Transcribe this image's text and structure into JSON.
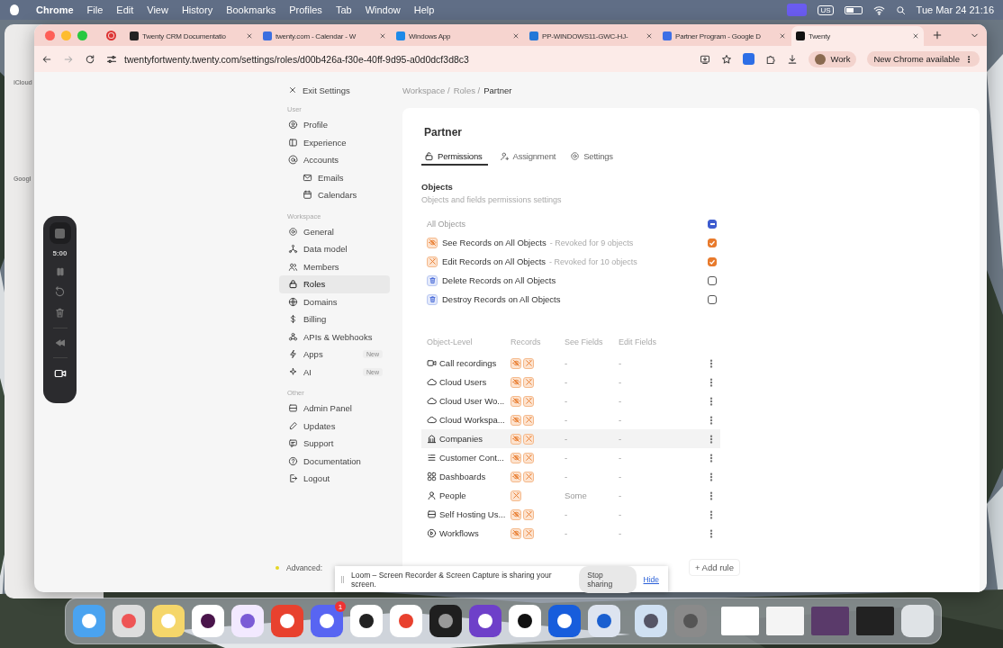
{
  "menubar": {
    "app": "Chrome",
    "menus": [
      "File",
      "Edit",
      "View",
      "History",
      "Bookmarks",
      "Profiles",
      "Tab",
      "Window",
      "Help"
    ],
    "input_source": "US",
    "clock": "Tue Mar 24  21:16"
  },
  "background_window": {
    "groups": [
      {
        "title": "iCloud"
      },
      {
        "title": "Googl"
      }
    ]
  },
  "browser": {
    "tabs": [
      {
        "title": "Twenty CRM Documentatio",
        "selected": false
      },
      {
        "title": "twenty.com - Calendar - W",
        "selected": false
      },
      {
        "title": "Windows App",
        "selected": false
      },
      {
        "title": "PP-WINDOWS11-GWC-HJ-",
        "selected": false
      },
      {
        "title": "Partner Program - Google D",
        "selected": false
      },
      {
        "title": "Twenty",
        "selected": true
      }
    ],
    "url": "twentyfortwenty.twenty.com/settings/roles/d00b426a-f30e-40ff-9d95-a0d0dcf3d8c3",
    "profile": "Work",
    "update_button": "New Chrome available"
  },
  "recorder": {
    "timer": "5:00"
  },
  "settings": {
    "exit": "Exit Settings",
    "groups": [
      {
        "title": "User",
        "items": [
          {
            "label": "Profile",
            "selected": false
          },
          {
            "label": "Experience",
            "selected": false
          },
          {
            "label": "Accounts",
            "selected": false,
            "children": [
              {
                "label": "Emails",
                "selected": false
              },
              {
                "label": "Calendars",
                "selected": false
              }
            ]
          }
        ]
      },
      {
        "title": "Workspace",
        "items": [
          {
            "label": "General",
            "selected": false
          },
          {
            "label": "Data model",
            "selected": false
          },
          {
            "label": "Members",
            "selected": false
          },
          {
            "label": "Roles",
            "selected": true
          },
          {
            "label": "Domains",
            "selected": false
          },
          {
            "label": "Billing",
            "selected": false
          },
          {
            "label": "APIs & Webhooks",
            "selected": false
          },
          {
            "label": "Apps",
            "selected": false,
            "badge": "New"
          },
          {
            "label": "AI",
            "selected": false,
            "badge": "New"
          }
        ]
      },
      {
        "title": "Other",
        "items": [
          {
            "label": "Admin Panel",
            "selected": false
          },
          {
            "label": "Updates",
            "selected": false
          },
          {
            "label": "Support",
            "selected": false
          },
          {
            "label": "Documentation",
            "selected": false
          },
          {
            "label": "Logout",
            "selected": false
          }
        ]
      }
    ],
    "advanced": "Advanced:"
  },
  "role": {
    "breadcrumb": [
      "Workspace /",
      "Roles /",
      "Partner"
    ],
    "title": "Partner",
    "tabs": [
      {
        "label": "Permissions",
        "selected": true
      },
      {
        "label": "Assignment",
        "selected": false
      },
      {
        "label": "Settings",
        "selected": false
      }
    ],
    "objects": {
      "title": "Objects",
      "description": "Objects and fields permissions settings",
      "all": {
        "label": "All Objects",
        "indeterminate": true
      },
      "permissions": [
        {
          "kind": "see",
          "label": "See Records on All Objects",
          "note": "- Revoked for 9 objects",
          "checked": true
        },
        {
          "kind": "edit",
          "label": "Edit Records on All Objects",
          "note": "- Revoked for 10 objects",
          "checked": true
        },
        {
          "kind": "delete",
          "label": "Delete Records on All Objects",
          "checked": false
        },
        {
          "kind": "destroy",
          "label": "Destroy Records on All Objects",
          "checked": false
        }
      ]
    },
    "table": {
      "columns": [
        "Object-Level",
        "Records",
        "See Fields",
        "Edit Fields"
      ],
      "rows": [
        {
          "name": "Call recordings",
          "records": [
            {
              "kind": "see"
            },
            {
              "kind": "edit"
            }
          ],
          "see_fields": "-",
          "edit_fields": "-",
          "highlighted": false
        },
        {
          "name": "Cloud Users",
          "records": [
            {
              "kind": "see"
            },
            {
              "kind": "edit"
            }
          ],
          "see_fields": "-",
          "edit_fields": "-",
          "highlighted": false
        },
        {
          "name": "Cloud User Wo...",
          "records": [
            {
              "kind": "see"
            },
            {
              "kind": "edit"
            }
          ],
          "see_fields": "-",
          "edit_fields": "-",
          "highlighted": false
        },
        {
          "name": "Cloud Workspa...",
          "records": [
            {
              "kind": "see"
            },
            {
              "kind": "edit"
            }
          ],
          "see_fields": "-",
          "edit_fields": "-",
          "highlighted": false
        },
        {
          "name": "Companies",
          "records": [
            {
              "kind": "see"
            },
            {
              "kind": "edit"
            }
          ],
          "see_fields": "-",
          "edit_fields": "-",
          "highlighted": true
        },
        {
          "name": "Customer Cont...",
          "records": [
            {
              "kind": "see"
            },
            {
              "kind": "edit"
            }
          ],
          "see_fields": "-",
          "edit_fields": "-",
          "highlighted": false
        },
        {
          "name": "Dashboards",
          "records": [
            {
              "kind": "see"
            },
            {
              "kind": "edit"
            }
          ],
          "see_fields": "-",
          "edit_fields": "-",
          "highlighted": false
        },
        {
          "name": "People",
          "records": [
            {
              "kind": "edit"
            }
          ],
          "see_fields": "Some",
          "edit_fields": "-",
          "highlighted": false
        },
        {
          "name": "Self Hosting Us...",
          "records": [
            {
              "kind": "see"
            },
            {
              "kind": "edit"
            }
          ],
          "see_fields": "-",
          "edit_fields": "-",
          "highlighted": false
        },
        {
          "name": "Workflows",
          "records": [
            {
              "kind": "see"
            },
            {
              "kind": "edit"
            }
          ],
          "see_fields": "-",
          "edit_fields": "-",
          "highlighted": false
        }
      ],
      "add_rule": "+ Add rule"
    }
  },
  "share_bar": {
    "message": "Loom – Screen Recorder & Screen Capture is sharing your screen.",
    "stop": "Stop sharing",
    "hide": "Hide"
  },
  "dock": {
    "badge": "1"
  }
}
